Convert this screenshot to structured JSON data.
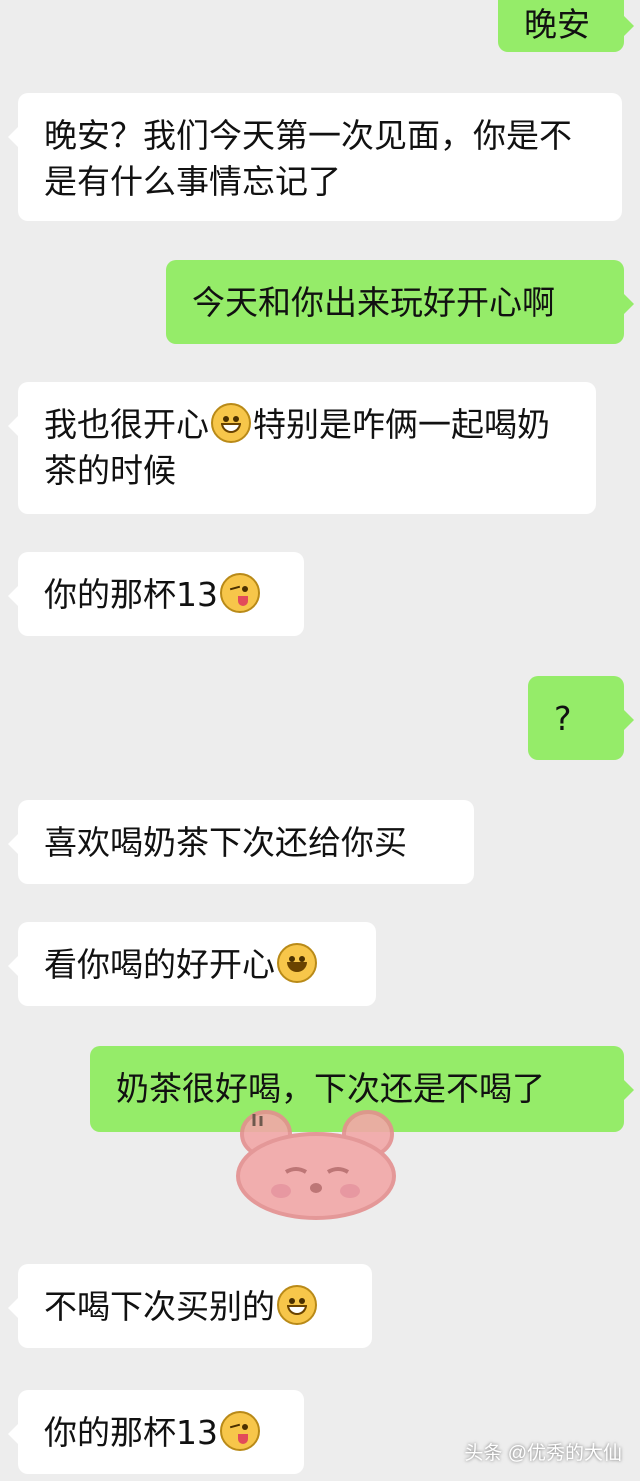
{
  "messages": [
    {
      "text": "晚安"
    },
    {
      "text": "晚安？我们今天第一次见面，你是不是有什么事情忘记了"
    },
    {
      "text": "今天和你出来玩好开心啊"
    },
    {
      "text_before": "我也很开心",
      "emoji": "grinning-emoji",
      "text_after": "特别是咋俩一起喝奶茶的时候"
    },
    {
      "text_before": "你的那杯13",
      "emoji": "winking-tongue-emoji"
    },
    {
      "text": "?"
    },
    {
      "text": "喜欢喝奶茶下次还给你买"
    },
    {
      "text_before": "看你喝的好开心",
      "emoji": "smiling-emoji"
    },
    {
      "text": "奶茶很好喝，下次还是不喝了"
    },
    {
      "text_before": "不喝下次买别的",
      "emoji": "grinning-emoji"
    },
    {
      "text_before": "你的那杯13",
      "emoji": "winking-tongue-emoji"
    }
  ],
  "sticker": {
    "name": "pink-bear-sticker",
    "color": "#f2a8a8"
  },
  "watermark": "头条 @优秀的大仙",
  "colors": {
    "background": "#ededed",
    "incoming_bubble": "#ffffff",
    "outgoing_bubble": "#95ec69",
    "text": "#111111"
  }
}
